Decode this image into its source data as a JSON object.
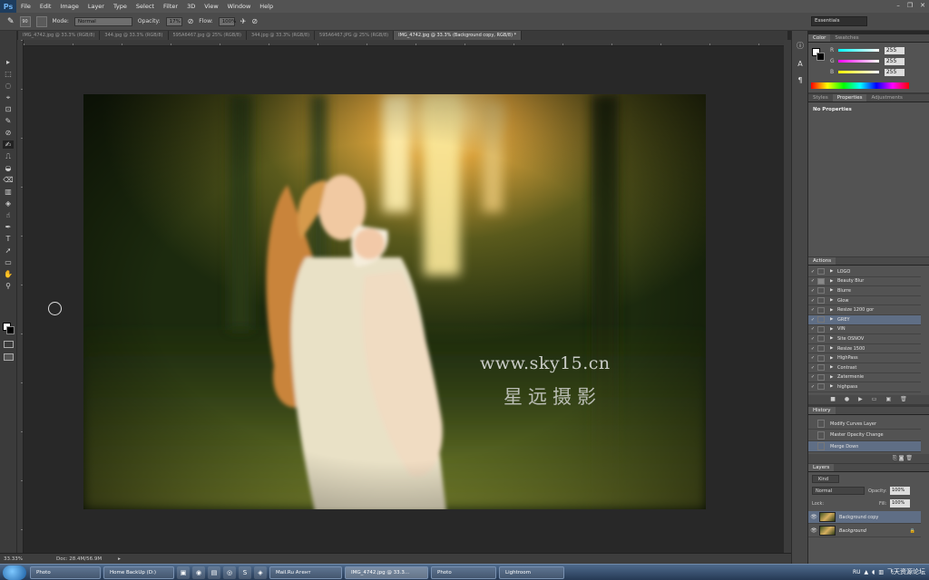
{
  "app": {
    "logo": "Ps"
  },
  "menu": [
    "File",
    "Edit",
    "Image",
    "Layer",
    "Type",
    "Select",
    "Filter",
    "3D",
    "View",
    "Window",
    "Help"
  ],
  "window_controls": [
    "–",
    "❐",
    "✕"
  ],
  "options": {
    "brush_size": "90",
    "mode_label": "Mode:",
    "mode_value": "Normal",
    "opacity_label": "Opacity:",
    "opacity_value": "17%",
    "flow_label": "Flow:",
    "flow_value": "100%",
    "workspace": "Essentials"
  },
  "tabs": [
    "IMG_4742.jpg @ 33.3% (RGB/8)",
    "344.jpg @ 33.3% (RGB/8)",
    "595A6467.jpg @ 25% (RGB/8)",
    "344.jpg @ 33.3% (RGB/8)",
    "595A6467.JPG @ 25% (RGB/8)",
    "IMG_4742.jpg @ 33.3% (Background copy, RGB/8) *"
  ],
  "tools": [
    "▸",
    "⬚",
    "◌",
    "⌖",
    "⊡",
    "✎",
    "⊘",
    "✍",
    "⎍",
    "◒",
    "⌫",
    "▥",
    "◈",
    "☝",
    "✒",
    "T",
    "➚",
    "▭",
    "✋",
    "⚲"
  ],
  "watermark": {
    "line1": "www.sky15.cn",
    "line2": "星远摄影"
  },
  "status": {
    "zoom": "33.33%",
    "doc": "Doc: 28.4M/56.9M"
  },
  "color_panel": {
    "tabs": [
      "Color",
      "Swatches"
    ],
    "channels": [
      {
        "label": "R",
        "value": "255"
      },
      {
        "label": "G",
        "value": "255"
      },
      {
        "label": "B",
        "value": "255"
      }
    ]
  },
  "properties_panel": {
    "tabs": [
      "Styles",
      "Properties",
      "Adjustments"
    ],
    "empty_text": "No Properties"
  },
  "actions_panel": {
    "title": "Actions",
    "items": [
      "LOGO",
      "Beauty Blur",
      "Blurre",
      "Glow",
      "Resize 1200 gor",
      "GREY",
      "VIN",
      "Site OSNOV",
      "Resize 1500",
      "HighPass",
      "Contrast",
      "Zatermenie",
      "highpass"
    ],
    "selected_index": 5
  },
  "history_panel": {
    "title": "History",
    "items": [
      "Modify Curves Layer",
      "Master Opacity Change",
      "Merge Down"
    ],
    "selected_index": 2
  },
  "layers_panel": {
    "title": "Layers",
    "kind": "Kind",
    "blend": "Normal",
    "opacity_label": "Opacity:",
    "opacity_value": "100%",
    "lock_label": "Lock:",
    "fill_label": "Fill:",
    "fill_value": "100%",
    "layers": [
      {
        "name": "Background copy",
        "selected": true
      },
      {
        "name": "Background",
        "selected": false
      }
    ]
  },
  "taskbar": {
    "items": [
      "Photo",
      "Home BackUp (D:)",
      "Mail.Ru Агент",
      "IMG_4742.jpg @ 33.3...",
      "Photo",
      "Lightroom"
    ],
    "lang": "RU",
    "tray_text": "飞天资源论坛"
  }
}
